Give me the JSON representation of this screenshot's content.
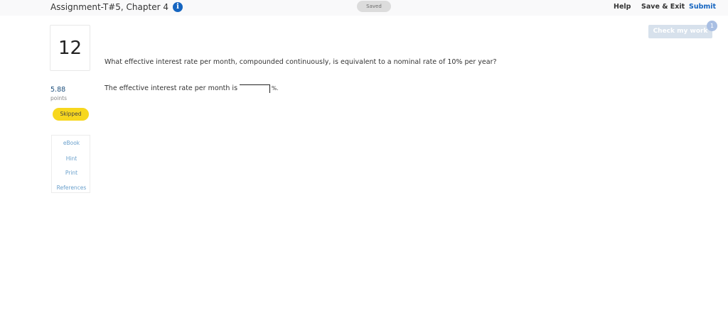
{
  "header": {
    "title": "Assignment-T#5, Chapter 4",
    "info_icon": "i",
    "status": "Saved",
    "help_label": "Help",
    "save_exit_label": "Save & Exit",
    "submit_label": "Submit"
  },
  "check_work": {
    "label": "Check my work",
    "badge_count": "1"
  },
  "question": {
    "number": "12",
    "points_value": "5.88",
    "points_label": "points",
    "status_badge": "Skipped",
    "prompt": "What effective interest rate per month, compounded continuously, is equivalent to a nominal rate of 10% per year?",
    "answer_prefix": "The effective interest rate per month is",
    "answer_value": "",
    "answer_suffix": "%."
  },
  "resources": {
    "items": [
      "eBook",
      "Hint",
      "Print",
      "References"
    ]
  },
  "colors": {
    "accent": "#1565c0",
    "skipped": "#f7d71e",
    "check_button": "#d7e1ec"
  }
}
